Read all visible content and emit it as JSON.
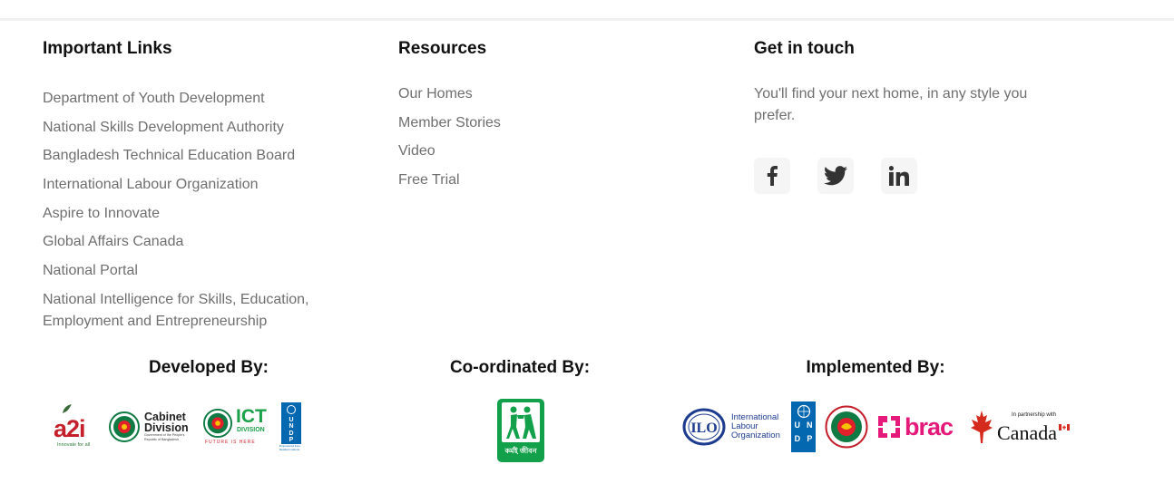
{
  "important_links": {
    "title": "Important Links",
    "items": [
      "Department of Youth Development",
      "National Skills Development Authority",
      "Bangladesh Technical Education Board",
      "International Labour Organization",
      "Aspire to Innovate",
      "Global Affairs Canada",
      "National Portal",
      "National Intelligence for Skills, Education, Employment and Entrepreneurship"
    ]
  },
  "resources": {
    "title": "Resources",
    "items": [
      "Our Homes",
      "Member Stories",
      "Video",
      "Free Trial"
    ]
  },
  "get_in_touch": {
    "title": "Get in touch",
    "text": "You'll find your next home, in any style you prefer.",
    "socials": [
      {
        "name": "facebook-icon"
      },
      {
        "name": "twitter-icon"
      },
      {
        "name": "linkedin-icon"
      }
    ]
  },
  "developed_by": {
    "title": "Developed By:",
    "a2i": {
      "mark": "a2i",
      "tagline": "Innovate for all"
    },
    "cabinet": {
      "line1": "Cabinet",
      "line2": "Division",
      "sub1": "Government of the People's",
      "sub2": "Republic of Bangladesh"
    },
    "ict": {
      "line1": "ICT",
      "line2": "DIVISION",
      "tagline": "FUTURE IS HERE"
    },
    "undp": {
      "letters": [
        "U",
        "N",
        "D",
        "P"
      ],
      "tagline": "Empowered lives. Resilient nations."
    }
  },
  "coordinated_by": {
    "title": "Co-ordinated By:",
    "logo_text": "কর্মই জীবন"
  },
  "implemented_by": {
    "title": "Implemented By:",
    "ilo": {
      "mark": "ILO",
      "line1": "International",
      "line2": "Labour",
      "line3": "Organization"
    },
    "undp": {
      "letters": [
        "U",
        "N",
        "D",
        "P"
      ]
    },
    "brac": {
      "text": "brac"
    },
    "canada": {
      "small": "In partnership with",
      "word": "Canada"
    }
  },
  "colors": {
    "muted_text": "#6f6f6f",
    "bd_green": "#006a4e",
    "bd_red": "#e0202a",
    "undp_blue": "#0468b1",
    "brac_pink": "#e5197a",
    "canada_red": "#d52b1e",
    "ilo_blue": "#1d3c8f",
    "coord_green": "#12a04a"
  }
}
